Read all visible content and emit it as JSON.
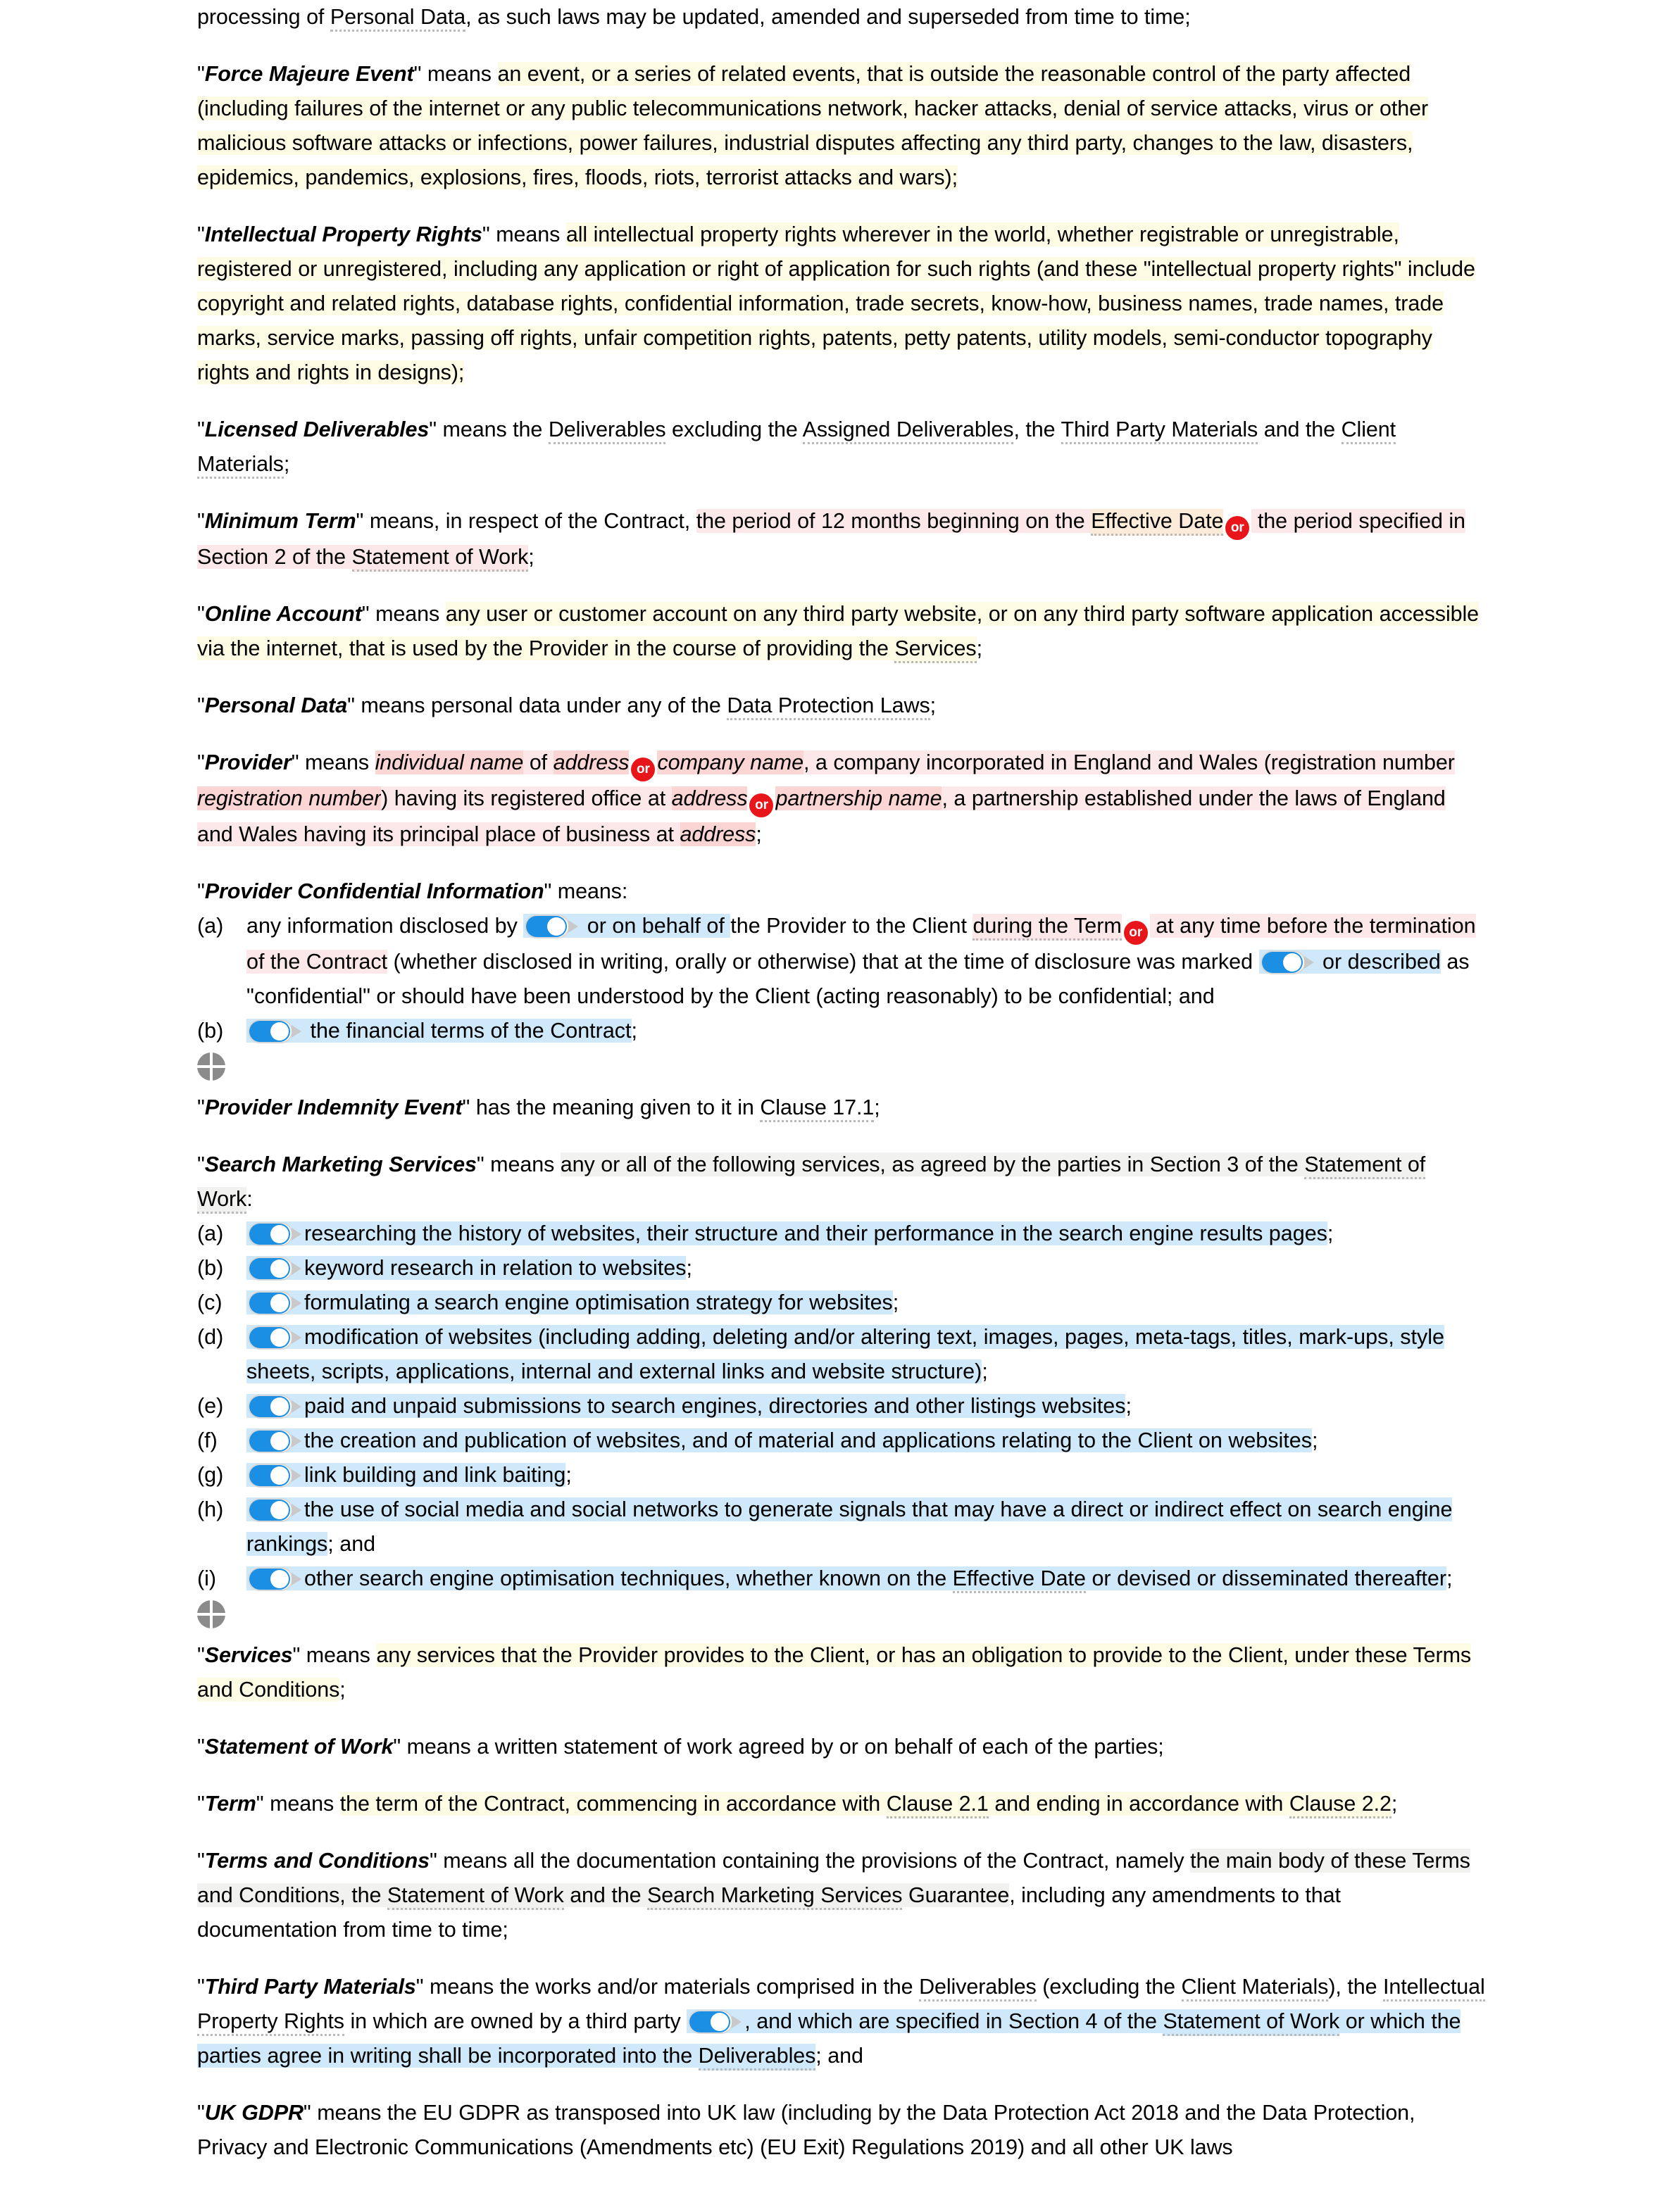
{
  "document": {
    "type": "contract-definitions",
    "colors": {
      "highlight_yellow": "#fdfbe3",
      "highlight_pink": "#fce8e8",
      "highlight_pink_dark": "#fbd5d3",
      "highlight_blue": "#cfe8fa",
      "highlight_gray": "#f1f1f0",
      "highlight_peach": "#fcebd9",
      "or_badge_red": "#e8151b",
      "toggle_blue": "#1a8fe3",
      "handle_gray": "#8b8b8b",
      "dotted_underline": "#b9b9b9"
    },
    "icons": {
      "or_badge": "or",
      "toggle": "toggle-switch-on",
      "handle": "move-handle-icon"
    }
  },
  "continuation": {
    "line": "processing of ",
    "term": "Personal Data",
    "rest": ", as such laws may be updated, amended and superseded from time to time;"
  },
  "definitions": {
    "force_majeure": {
      "term": "Force Majeure Event",
      "lead": "\" means ",
      "body": "an event, or a series of related events, that is outside the reasonable control of the party affected (including failures of the internet or any public telecommunications network, hacker attacks, denial of service attacks, virus or other malicious software attacks or infections, power failures, industrial disputes affecting any third party, changes to the law, disasters, epidemics, pandemics, explosions, fires, floods, riots, terrorist attacks and wars);"
    },
    "ipr": {
      "term": "Intellectual Property Rights",
      "lead": "\" means ",
      "body": "all intellectual property rights wherever in the world, whether registrable or unregistrable, registered or unregistered, including any application or right of application for such rights (and these \"intellectual property rights\" include copyright and related rights, database rights, confidential information, trade secrets, know-how, business names, trade names, trade marks, service marks, passing off rights, unfair competition rights, patents, petty patents, utility models, semi-conductor topography rights and rights in designs);"
    },
    "licensed_deliverables": {
      "term": "Licensed Deliverables",
      "p1": "\" means the ",
      "t1": "Deliverables",
      "p2": " excluding the ",
      "t2": "Assigned Deliverables",
      "p3": ", the ",
      "t3": "Third Party Materials",
      "p4": " and the ",
      "t4": "Client Materials",
      "p5": ";"
    },
    "minimum_term": {
      "term": "Minimum Term",
      "p1": "\" means, in respect of the Contract, ",
      "opt_a_1": "the period of 12 months beginning on the ",
      "opt_a_term": "Effective Date",
      "or": "or",
      "opt_b": " the period specified in Section 2 of the ",
      "opt_b_term": "Statement of Work",
      "p_end": ";"
    },
    "online_account": {
      "term": "Online Account",
      "p1": "\" means ",
      "body_1": "any user or customer account on any third party website, or on any third party software application accessible via the internet, that is used by the Provider in the course of providing the ",
      "body_term": "Services",
      "body_end": ";"
    },
    "personal_data": {
      "term": "Personal Data",
      "p1": "\" means personal data under any of the ",
      "t1": "Data Protection Laws",
      "p2": ";"
    },
    "provider": {
      "term": "Provider",
      "p1": "\" means ",
      "f1": "individual name",
      "p2": " of ",
      "f2": "address",
      "or": "or",
      "f3": "company name",
      "p3": ", a company incorporated in England and Wales (registration number ",
      "f4": "registration number",
      "p4": ") having its registered office at ",
      "f5": "address",
      "or2": "or",
      "f6": "partnership name",
      "p5": ", a partnership established under the laws of England and Wales having its principal place of business at ",
      "f7": "address",
      "p6": ";"
    },
    "provider_confidential": {
      "term": "Provider Confidential Information",
      "lead": "\" means:",
      "items": [
        {
          "marker": "(a)",
          "seg1": "any information disclosed by ",
          "toggle1": "toggle-switch-on",
          "seg2": " or on behalf of ",
          "seg3": "the Provider to the Client ",
          "seg4": "during the Term",
          "or": "or",
          "seg5": " at any time before the termination of the Contract",
          "seg6": " (whether disclosed in writing, orally or otherwise) that at the time of disclosure was marked ",
          "toggle2": "toggle-switch-on",
          "seg7": " or described",
          "seg8": " as \"confidential\" or should have been understood by the Client (acting reasonably) to be confidential; and"
        },
        {
          "marker": "(b)",
          "toggle1": "toggle-switch-on",
          "seg1": " the financial terms of the Contract",
          "seg2": ";"
        }
      ]
    },
    "provider_indemnity": {
      "term": "Provider Indemnity Event",
      "p1": "\" has the meaning given to it in ",
      "t1": "Clause 17.1",
      "p2": ";"
    },
    "search_marketing": {
      "term": "Search Marketing Services",
      "lead_1": "\" means ",
      "lead_2": "any or all of the following services, as agreed by the parties in Section 3 of the ",
      "lead_term": "Statement of Work",
      "lead_end": ":",
      "items": [
        {
          "marker": "(a)",
          "text": "researching the history of websites, their structure and their performance in the search engine results pages",
          "tail": ";"
        },
        {
          "marker": "(b)",
          "text": "keyword research in relation to websites",
          "tail": ";"
        },
        {
          "marker": "(c)",
          "text": "formulating a search engine optimisation strategy for websites",
          "tail": ";"
        },
        {
          "marker": "(d)",
          "text": "modification of websites (including adding, deleting and/or altering text, images, pages, meta-tags, titles, mark-ups, style sheets, scripts, applications, internal and external links and website structure)",
          "tail": ";"
        },
        {
          "marker": "(e)",
          "text": "paid and unpaid submissions to search engines, directories and other listings websites",
          "tail": ";"
        },
        {
          "marker": "(f)",
          "text": "the creation and publication of websites, and of material and applications relating to the Client on websites",
          "tail": ";"
        },
        {
          "marker": "(g)",
          "text": "link building and link baiting",
          "tail": ";"
        },
        {
          "marker": "(h)",
          "text": "the use of social media and social networks to generate signals that may have a direct or indirect effect on search engine rankings",
          "tail": "; and"
        },
        {
          "marker": "(i)",
          "text_a": "other search engine optimisation techniques, whether known on the ",
          "term_b": "Effective Date",
          "text_c": " or devised or disseminated thereafter",
          "tail": ";"
        }
      ]
    },
    "services": {
      "term": "Services",
      "p1": "\" means ",
      "body": "any services that the Provider provides to the Client, or has an obligation to provide to the Client, under these Terms and Conditions",
      "p2": ";"
    },
    "statement_of_work": {
      "term": "Statement of Work",
      "p1": "\" means a written statement of work agreed by or on behalf of each of the parties;"
    },
    "term_def": {
      "term": "Term",
      "p1": "\" means ",
      "body_1": "the term of the Contract, commencing in accordance with ",
      "t1": "Clause 2.1",
      "body_2": " and ending in accordance with ",
      "t2": "Clause 2.2",
      "p2": ";"
    },
    "terms_conditions": {
      "term": "Terms and Conditions",
      "p1": "\" means all the documentation containing the provisions of the Contract, namely ",
      "body_1": "the main body of these Terms and Conditions, the ",
      "t1": "Statement of Work",
      "body_2": " and the ",
      "t2": "Search Marketing Services",
      "body_3": " Guarantee",
      "p2": ", including any amendments to that documentation from time to time;"
    },
    "third_party_materials": {
      "term": "Third Party Materials",
      "p1": "\" means the works and/or materials comprised in the ",
      "t1": "Deliverables",
      "p2": " (excluding the ",
      "t2": "Client Materials",
      "p3": "), the ",
      "t3": "Intellectual Property Rights",
      "p4": " in which are owned by a third party ",
      "toggle": "toggle-switch-on",
      "p5": ", and which are specified in Section 4 of the ",
      "t4": "Statement of Work",
      "p6": " or which the parties agree in writing shall be incorporated into the ",
      "t5": "Deliverables",
      "p7": "; and"
    },
    "uk_gdpr": {
      "term": "UK GDPR",
      "p1": "\" means the EU GDPR as transposed into UK law (including by the Data Protection Act 2018 and the Data Protection, Privacy and Electronic Communications (Amendments etc) (EU Exit) Regulations 2019) and all other UK laws"
    }
  }
}
